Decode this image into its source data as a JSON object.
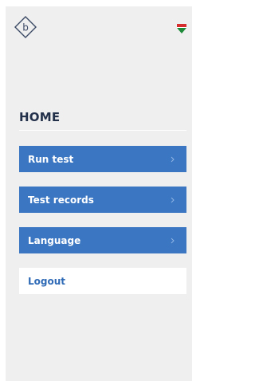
{
  "header": {
    "logo_icon": "b-diamond-logo",
    "logo_letter": "b",
    "flag_icon": "flag-icon"
  },
  "main": {
    "title": "HOME",
    "menu": [
      {
        "label": "Run test",
        "icon": "chevron-right-icon"
      },
      {
        "label": "Test records",
        "icon": "chevron-right-icon"
      },
      {
        "label": "Language",
        "icon": "chevron-right-icon"
      }
    ],
    "logout_label": "Logout"
  },
  "colors": {
    "background": "#efefef",
    "primary": "#3a76c2",
    "title": "#23304a",
    "logo_outline": "#3d4a66",
    "flag_red": "#d62e2e",
    "flag_green": "#1f8a3a"
  }
}
